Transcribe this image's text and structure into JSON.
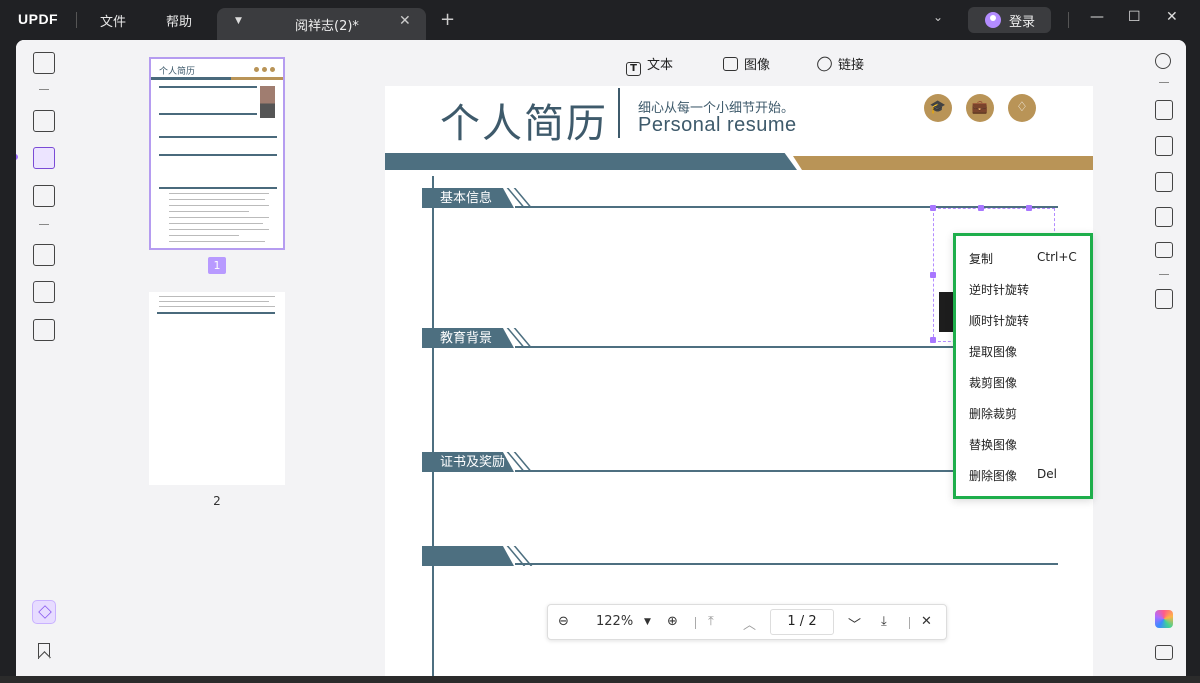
{
  "app": {
    "logo": "UPDF"
  },
  "titlebar": {
    "menu": [
      "文件",
      "帮助"
    ],
    "tab_name": "阅祥志(2)*",
    "login_label": "登录"
  },
  "edit_tools": [
    "文本",
    "图像",
    "链接"
  ],
  "thumbnails": {
    "pages": [
      "1",
      "2"
    ],
    "selected": "1"
  },
  "document": {
    "title_cn": "个人简历",
    "subtitle_cn": "细心从每一个小细节开始。",
    "title_en": "Personal resume",
    "sections": [
      "基本信息",
      "教育背景",
      "证书及奖励",
      ""
    ]
  },
  "context_menu": {
    "items": [
      {
        "label": "复制",
        "shortcut": "Ctrl+C"
      },
      {
        "label": "逆时针旋转",
        "shortcut": ""
      },
      {
        "label": "顺时针旋转",
        "shortcut": ""
      },
      {
        "label": "提取图像",
        "shortcut": ""
      },
      {
        "label": "裁剪图像",
        "shortcut": ""
      },
      {
        "label": "删除裁剪",
        "shortcut": ""
      },
      {
        "label": "替换图像",
        "shortcut": ""
      },
      {
        "label": "删除图像",
        "shortcut": "Del"
      }
    ],
    "highlight_color": "#1eae4b"
  },
  "zoom_bar": {
    "zoom": "122%",
    "current_page": "1",
    "total_pages": "2",
    "separator": "/"
  },
  "colors": {
    "accent": "#9a6bff",
    "resume_blue": "#4d6f80",
    "resume_gold": "#b99457"
  }
}
